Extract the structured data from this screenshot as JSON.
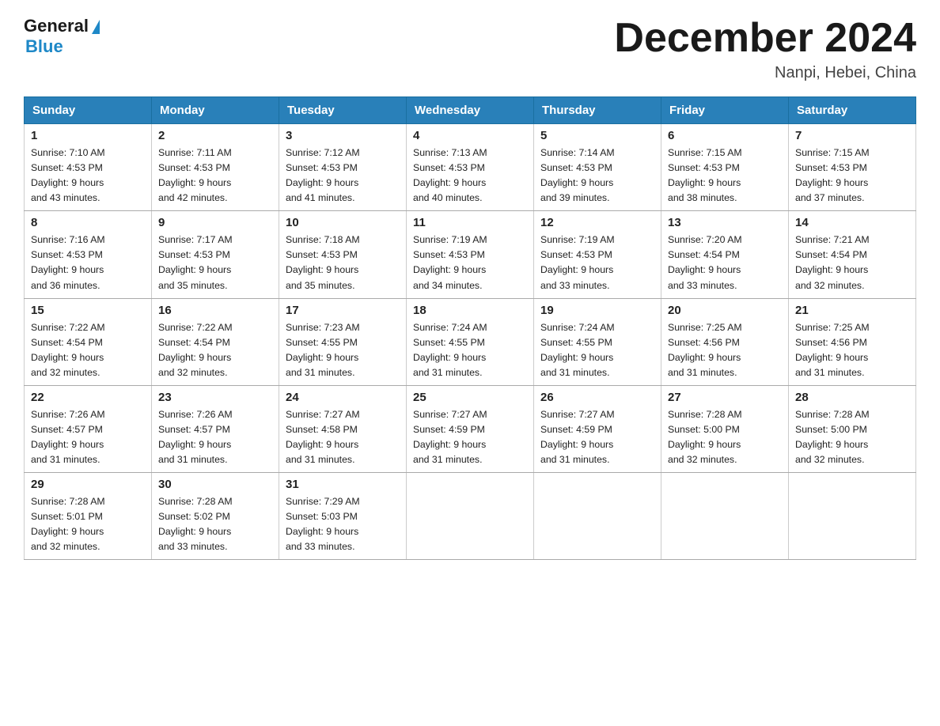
{
  "header": {
    "logo_general": "General",
    "logo_blue": "Blue",
    "month_title": "December 2024",
    "location": "Nanpi, Hebei, China"
  },
  "days_of_week": [
    "Sunday",
    "Monday",
    "Tuesday",
    "Wednesday",
    "Thursday",
    "Friday",
    "Saturday"
  ],
  "weeks": [
    [
      {
        "day": "1",
        "sunrise": "7:10 AM",
        "sunset": "4:53 PM",
        "daylight": "9 hours and 43 minutes."
      },
      {
        "day": "2",
        "sunrise": "7:11 AM",
        "sunset": "4:53 PM",
        "daylight": "9 hours and 42 minutes."
      },
      {
        "day": "3",
        "sunrise": "7:12 AM",
        "sunset": "4:53 PM",
        "daylight": "9 hours and 41 minutes."
      },
      {
        "day": "4",
        "sunrise": "7:13 AM",
        "sunset": "4:53 PM",
        "daylight": "9 hours and 40 minutes."
      },
      {
        "day": "5",
        "sunrise": "7:14 AM",
        "sunset": "4:53 PM",
        "daylight": "9 hours and 39 minutes."
      },
      {
        "day": "6",
        "sunrise": "7:15 AM",
        "sunset": "4:53 PM",
        "daylight": "9 hours and 38 minutes."
      },
      {
        "day": "7",
        "sunrise": "7:15 AM",
        "sunset": "4:53 PM",
        "daylight": "9 hours and 37 minutes."
      }
    ],
    [
      {
        "day": "8",
        "sunrise": "7:16 AM",
        "sunset": "4:53 PM",
        "daylight": "9 hours and 36 minutes."
      },
      {
        "day": "9",
        "sunrise": "7:17 AM",
        "sunset": "4:53 PM",
        "daylight": "9 hours and 35 minutes."
      },
      {
        "day": "10",
        "sunrise": "7:18 AM",
        "sunset": "4:53 PM",
        "daylight": "9 hours and 35 minutes."
      },
      {
        "day": "11",
        "sunrise": "7:19 AM",
        "sunset": "4:53 PM",
        "daylight": "9 hours and 34 minutes."
      },
      {
        "day": "12",
        "sunrise": "7:19 AM",
        "sunset": "4:53 PM",
        "daylight": "9 hours and 33 minutes."
      },
      {
        "day": "13",
        "sunrise": "7:20 AM",
        "sunset": "4:54 PM",
        "daylight": "9 hours and 33 minutes."
      },
      {
        "day": "14",
        "sunrise": "7:21 AM",
        "sunset": "4:54 PM",
        "daylight": "9 hours and 32 minutes."
      }
    ],
    [
      {
        "day": "15",
        "sunrise": "7:22 AM",
        "sunset": "4:54 PM",
        "daylight": "9 hours and 32 minutes."
      },
      {
        "day": "16",
        "sunrise": "7:22 AM",
        "sunset": "4:54 PM",
        "daylight": "9 hours and 32 minutes."
      },
      {
        "day": "17",
        "sunrise": "7:23 AM",
        "sunset": "4:55 PM",
        "daylight": "9 hours and 31 minutes."
      },
      {
        "day": "18",
        "sunrise": "7:24 AM",
        "sunset": "4:55 PM",
        "daylight": "9 hours and 31 minutes."
      },
      {
        "day": "19",
        "sunrise": "7:24 AM",
        "sunset": "4:55 PM",
        "daylight": "9 hours and 31 minutes."
      },
      {
        "day": "20",
        "sunrise": "7:25 AM",
        "sunset": "4:56 PM",
        "daylight": "9 hours and 31 minutes."
      },
      {
        "day": "21",
        "sunrise": "7:25 AM",
        "sunset": "4:56 PM",
        "daylight": "9 hours and 31 minutes."
      }
    ],
    [
      {
        "day": "22",
        "sunrise": "7:26 AM",
        "sunset": "4:57 PM",
        "daylight": "9 hours and 31 minutes."
      },
      {
        "day": "23",
        "sunrise": "7:26 AM",
        "sunset": "4:57 PM",
        "daylight": "9 hours and 31 minutes."
      },
      {
        "day": "24",
        "sunrise": "7:27 AM",
        "sunset": "4:58 PM",
        "daylight": "9 hours and 31 minutes."
      },
      {
        "day": "25",
        "sunrise": "7:27 AM",
        "sunset": "4:59 PM",
        "daylight": "9 hours and 31 minutes."
      },
      {
        "day": "26",
        "sunrise": "7:27 AM",
        "sunset": "4:59 PM",
        "daylight": "9 hours and 31 minutes."
      },
      {
        "day": "27",
        "sunrise": "7:28 AM",
        "sunset": "5:00 PM",
        "daylight": "9 hours and 32 minutes."
      },
      {
        "day": "28",
        "sunrise": "7:28 AM",
        "sunset": "5:00 PM",
        "daylight": "9 hours and 32 minutes."
      }
    ],
    [
      {
        "day": "29",
        "sunrise": "7:28 AM",
        "sunset": "5:01 PM",
        "daylight": "9 hours and 32 minutes."
      },
      {
        "day": "30",
        "sunrise": "7:28 AM",
        "sunset": "5:02 PM",
        "daylight": "9 hours and 33 minutes."
      },
      {
        "day": "31",
        "sunrise": "7:29 AM",
        "sunset": "5:03 PM",
        "daylight": "9 hours and 33 minutes."
      },
      null,
      null,
      null,
      null
    ]
  ],
  "labels": {
    "sunrise": "Sunrise:",
    "sunset": "Sunset:",
    "daylight": "Daylight:"
  }
}
